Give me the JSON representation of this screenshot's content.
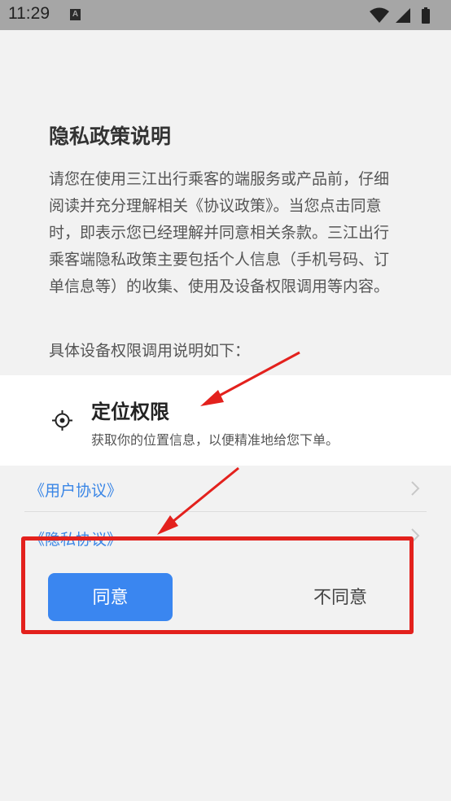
{
  "status_bar": {
    "time": "11:29",
    "notification": "A"
  },
  "dialog": {
    "title": "隐私政策说明",
    "description": "请您在使用三江出行乘客的端服务或产品前，仔细阅读并充分理解相关《协议政策》。当您点击同意时，即表示您已经理解并同意相关条款。三江出行乘客端隐私政策主要包括个人信息（手机号码、订单信息等）的收集、使用及设备权限调用等内容。",
    "permission_intro": "具体设备权限调用说明如下：",
    "permission": {
      "title": "定位权限",
      "description": "获取你的位置信息，以便精准地给您下单。"
    },
    "links": [
      {
        "label": "《用户协议》"
      },
      {
        "label": "《隐私协议》"
      }
    ],
    "agree_label": "同意",
    "disagree_label": "不同意"
  },
  "colors": {
    "accent": "#3a86f0",
    "link": "#3a86e6",
    "annotation": "#e3211d",
    "status_bar": "#a6a6a6"
  }
}
